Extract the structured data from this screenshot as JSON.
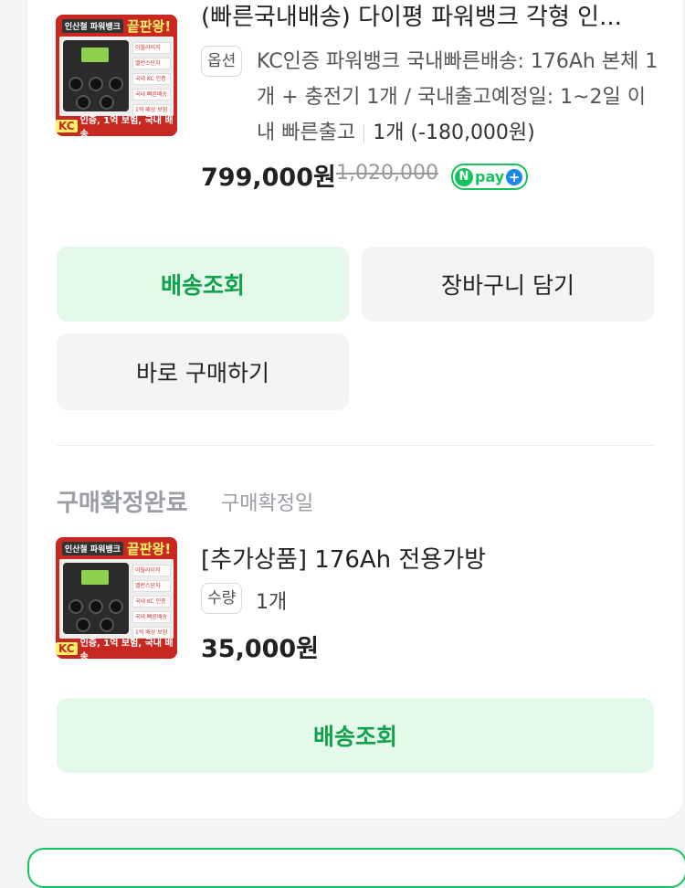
{
  "order1": {
    "title": "(빠른국내배송) 다이평 파워뱅크 각형 인...",
    "option_badge": "옵션",
    "option_text": "KC인증 파워뱅크 국내빠른배송: 176Ah 본체 1개 + 충전기 1개 / 국내출고예정일: 1~2일 이내 빠른출고",
    "quantity": "1개 (-180,000원)",
    "price": "799,000원",
    "original_price": "1,020,000",
    "npay_n": "N",
    "npay_label": "pay",
    "npay_plus": "+",
    "thumb": {
      "top_tag": "인산철 파워뱅크",
      "top_title": "끝판왕!",
      "list": [
        "이월라이저",
        "밸런스단자",
        "국내 KC 인증",
        "국내 빠른배송",
        "1억 배상 보험"
      ],
      "kc": "KC",
      "bottom_text": "인증, 1억 보험, 국내 배송"
    }
  },
  "buttons": {
    "track": "배송조회",
    "cart": "장바구니 담기",
    "buy_now": "바로 구매하기",
    "track2": "배송조회"
  },
  "order2": {
    "status": "구매확정완료",
    "status_sub": "구매확정일",
    "title": "[추가상품] 176Ah 전용가방",
    "qty_badge": "수량",
    "qty": "1개",
    "price": "35,000원"
  },
  "colors": {
    "accent_green": "#10a24a",
    "green_bg": "#e5f9eb",
    "npay_green": "#12c45b",
    "npay_blue": "#1a86f0"
  }
}
